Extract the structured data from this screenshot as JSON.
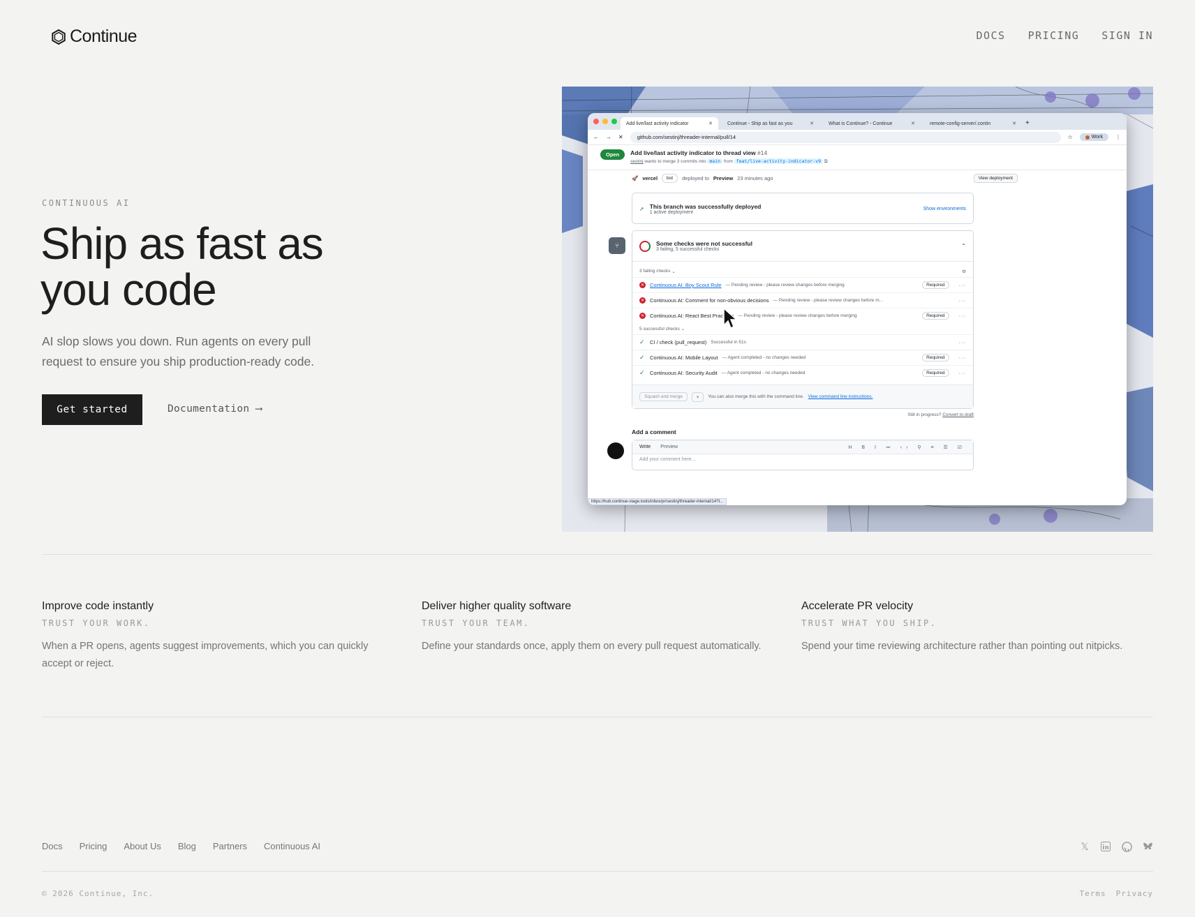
{
  "header": {
    "logo_text": "Continue",
    "nav": [
      "DOCS",
      "PRICING",
      "SIGN IN"
    ]
  },
  "hero": {
    "eyebrow": "CONTINUOUS AI",
    "headline": "Ship as fast as you code",
    "subtext": "AI slop slows you down. Run agents on every pull request to ensure you ship production-ready code.",
    "cta_primary": "Get started",
    "cta_secondary": "Documentation ⟶"
  },
  "screenshot": {
    "tabs": [
      "Add live/last activity indicator",
      "Continue - Ship as fast as you",
      "What is Continue? - Continue",
      "remote-config-server/.contin"
    ],
    "url": "github.com/sestinj/threader-internal/pull/14",
    "work_label": "Work",
    "pr_status": "Open",
    "pr_title": "Add live/last activity indicator to thread view",
    "pr_number": "#14",
    "pr_author": "sestinj",
    "pr_meta_mid": "wants to merge 3 commits into",
    "pr_base": "main",
    "pr_from": "from",
    "pr_branch": "feat/live-activity-indicator-v9",
    "deploy_actor": "vercel",
    "deploy_bot": "bot",
    "deploy_text": "deployed to",
    "deploy_env": "Preview",
    "deploy_time": "23 minutes ago",
    "view_deployment": "View deployment",
    "deployed_title": "This branch was successfully deployed",
    "deployed_sub": "1 active deployment",
    "show_env": "Show environments",
    "checks_title": "Some checks were not successful",
    "checks_sub": "3 failing, 5 successful checks",
    "failing_label": "3 failing checks",
    "failing": [
      {
        "name": "Continuous AI: Boy Scout Rule",
        "status": "— Pending review - please review changes before merging",
        "required": "Required"
      },
      {
        "name": "Continuous AI: Comment for non-obvious decisions",
        "status": "— Pending review - please review changes before m...",
        "required": ""
      },
      {
        "name": "Continuous AI: React Best Practices",
        "status": "— Pending review - please review changes before merging",
        "required": "Required"
      }
    ],
    "success_label": "5 successful checks",
    "success": [
      {
        "name": "CI / check (pull_request)",
        "status": "Successful in 51s",
        "required": ""
      },
      {
        "name": "Continuous AI: Mobile Layout",
        "status": "— Agent completed - no changes needed",
        "required": "Required"
      },
      {
        "name": "Continuous AI: Security Audit",
        "status": "— Agent completed - no changes needed",
        "required": "Required"
      }
    ],
    "merge_button": "Squash and merge",
    "merge_hint": "You can also merge this with the command line.",
    "merge_link": "View command line instructions.",
    "draft_hint": "Still in progress?",
    "draft_link": "Convert to draft",
    "add_comment": "Add a comment",
    "write_tab": "Write",
    "preview_tab": "Preview",
    "comment_placeholder": "Add your comment here...",
    "status_url": "https://hub.continue-stage.tools/inbox/pr/sestinj/threader-internal/14?t..."
  },
  "features": [
    {
      "title": "Improve code instantly",
      "tag": "TRUST YOUR WORK.",
      "body": "When a PR opens, agents suggest improvements, which you can quickly accept or reject."
    },
    {
      "title": "Deliver higher quality software",
      "tag": "TRUST YOUR TEAM.",
      "body": "Define your standards once, apply them on every pull request automatically."
    },
    {
      "title": "Accelerate PR velocity",
      "tag": "TRUST WHAT YOU SHIP.",
      "body": "Spend your time reviewing architecture rather than pointing out nitpicks."
    }
  ],
  "footer": {
    "links": [
      "Docs",
      "Pricing",
      "About Us",
      "Blog",
      "Partners",
      "Continuous AI"
    ],
    "social_icons": [
      "x-icon",
      "linkedin-icon",
      "github-icon",
      "bluesky-icon"
    ],
    "copyright": "© 2026 Continue, Inc.",
    "legal": [
      "Terms",
      "Privacy"
    ]
  }
}
